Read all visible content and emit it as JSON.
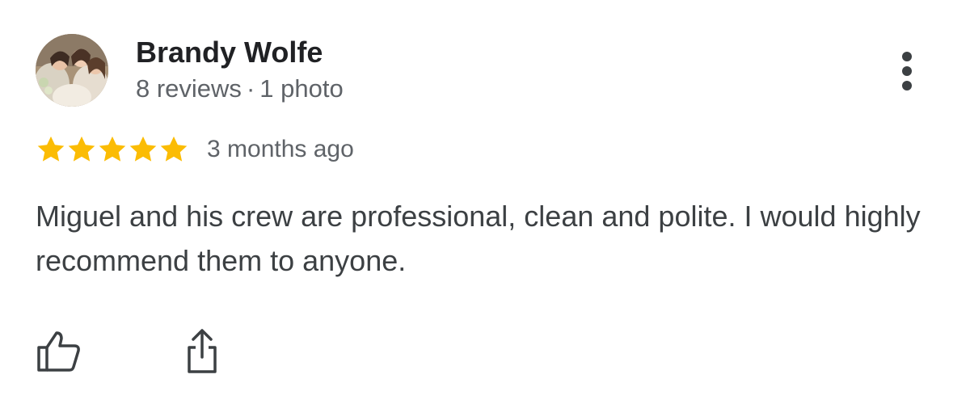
{
  "reviewer": {
    "name": "Brandy Wolfe",
    "reviews": "8 reviews",
    "separator": "·",
    "photos": "1 photo"
  },
  "rating": {
    "stars": 5,
    "max": 5,
    "color": "#fbbc04"
  },
  "review": {
    "date": "3 months ago",
    "text": "Miguel and his crew are professional, clean and polite. I would highly recommend them to anyone."
  },
  "actions": {
    "like_icon": "thumbs-up-icon",
    "share_icon": "share-icon",
    "more_icon": "more-vertical-icon"
  }
}
